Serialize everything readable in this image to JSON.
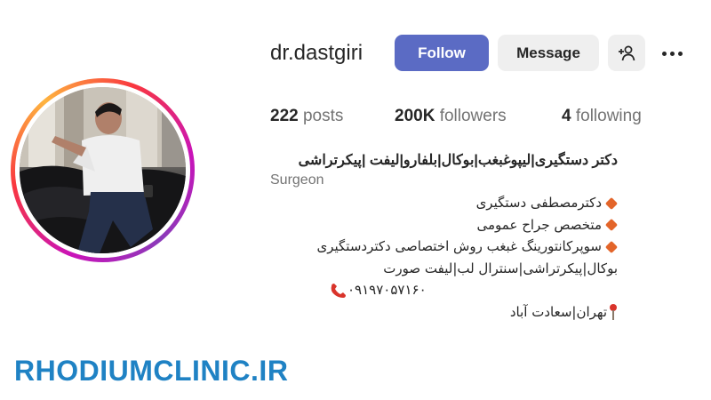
{
  "profile": {
    "username": "dr.dastgiri",
    "follow_label": "Follow",
    "message_label": "Message",
    "add_user_icon": "add-user-icon",
    "more_icon": "more-options-icon"
  },
  "stats": {
    "posts_count": "222",
    "posts_label": "posts",
    "followers_count": "200K",
    "followers_label": "followers",
    "following_count": "4",
    "following_label": "following"
  },
  "bio": {
    "name": "دکتر دستگیری|لیپوغبغب|بوکال|بلفارو|لیفت |پیکرتراشی",
    "category": "Surgeon",
    "lines": [
      "دکترمصطفی دستگیری",
      "متخصص جراح عمومی",
      "سوپرکانتورینگ غبغب روش اختصاصی دکتردستگیری",
      "بوکال|پیکرتراشی|سنترال لب|لیفت صورت",
      "۰۹۱۹۷۰۵۷۱۶۰",
      "تهران|سعادت آباد"
    ]
  },
  "watermark": "RHODIUMCLINIC.IR",
  "colors": {
    "follow_button": "#5b6bc4",
    "secondary_button": "#efefef",
    "diamond_bullet": "#e3652a",
    "watermark": "#1f82c4"
  }
}
